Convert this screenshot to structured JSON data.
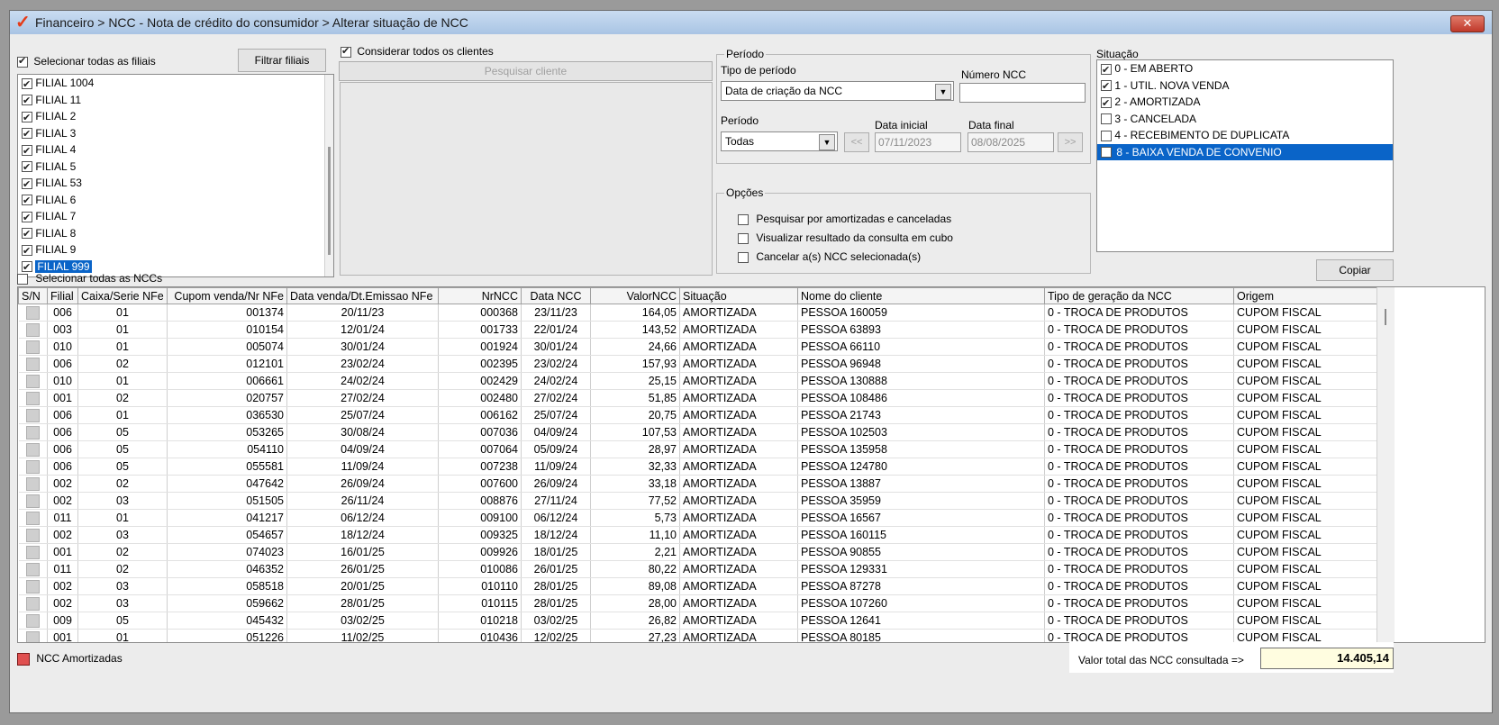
{
  "window": {
    "title": "Financeiro > NCC - Nota de crédito do consumidor > Alterar situação de NCC",
    "close_label": "✕"
  },
  "filiais": {
    "select_all_label": "Selecionar todas as filiais",
    "filter_button": "Filtrar filiais",
    "items": [
      "FILIAL 1004",
      "FILIAL 11",
      "FILIAL 2",
      "FILIAL 3",
      "FILIAL 4",
      "FILIAL 5",
      "FILIAL 53",
      "FILIAL 6",
      "FILIAL 7",
      "FILIAL 8",
      "FILIAL 9",
      "FILIAL 999"
    ],
    "selected": "FILIAL 999"
  },
  "clientes": {
    "consider_all_label": "Considerar todos os clientes",
    "search_button": "Pesquisar cliente"
  },
  "periodo": {
    "group_title": "Período",
    "tipo_label": "Tipo de período",
    "tipo_value": "Data de criação da NCC",
    "numero_label": "Número NCC",
    "numero_value": "",
    "periodo_label": "Período",
    "periodo_value": "Todas",
    "prev_label": "<<",
    "next_label": ">>",
    "data_inicial_label": "Data inicial",
    "data_inicial_value": "07/11/2023",
    "data_final_label": "Data final",
    "data_final_value": "08/08/2025"
  },
  "opcoes": {
    "group_title": "Opções",
    "items": [
      "Pesquisar por amortizadas e canceladas",
      "Visualizar resultado da consulta em cubo",
      "Cancelar a(s) NCC selecionada(s)"
    ]
  },
  "situacao": {
    "label": "Situação",
    "items": [
      {
        "label": "0 - EM ABERTO",
        "checked": true
      },
      {
        "label": "1 - UTIL. NOVA VENDA",
        "checked": true
      },
      {
        "label": "2 - AMORTIZADA",
        "checked": true
      },
      {
        "label": "3 - CANCELADA",
        "checked": false
      },
      {
        "label": "4 - RECEBIMENTO DE DUPLICATA",
        "checked": false
      },
      {
        "label": "8 - BAIXA VENDA DE CONVENIO",
        "checked": false
      }
    ],
    "selected": "8 - BAIXA VENDA DE CONVENIO"
  },
  "copiar_button": "Copiar",
  "select_all_ncc_label": "Selecionar todas as NCCs",
  "grid": {
    "columns": [
      "S/N",
      "Filial",
      "Caixa/Serie NFe",
      "Cupom venda/Nr NFe",
      "Data venda/Dt.Emissao NFe",
      "NrNCC",
      "Data NCC",
      "ValorNCC",
      "Situação",
      "Nome do cliente",
      "Tipo de geração da NCC",
      "Origem"
    ],
    "rows": [
      [
        "006",
        "01",
        "001374",
        "20/11/23",
        "000368",
        "23/11/23",
        "164,05",
        "AMORTIZADA",
        "PESSOA 160059",
        "0 - TROCA DE PRODUTOS",
        "CUPOM FISCAL"
      ],
      [
        "003",
        "01",
        "010154",
        "12/01/24",
        "001733",
        "22/01/24",
        "143,52",
        "AMORTIZADA",
        "PESSOA 63893",
        "0 - TROCA DE PRODUTOS",
        "CUPOM FISCAL"
      ],
      [
        "010",
        "01",
        "005074",
        "30/01/24",
        "001924",
        "30/01/24",
        "24,66",
        "AMORTIZADA",
        "PESSOA 66110",
        "0 - TROCA DE PRODUTOS",
        "CUPOM FISCAL"
      ],
      [
        "006",
        "02",
        "012101",
        "23/02/24",
        "002395",
        "23/02/24",
        "157,93",
        "AMORTIZADA",
        "PESSOA 96948",
        "0 - TROCA DE PRODUTOS",
        "CUPOM FISCAL"
      ],
      [
        "010",
        "01",
        "006661",
        "24/02/24",
        "002429",
        "24/02/24",
        "25,15",
        "AMORTIZADA",
        "PESSOA 130888",
        "0 - TROCA DE PRODUTOS",
        "CUPOM FISCAL"
      ],
      [
        "001",
        "02",
        "020757",
        "27/02/24",
        "002480",
        "27/02/24",
        "51,85",
        "AMORTIZADA",
        "PESSOA 108486",
        "0 - TROCA DE PRODUTOS",
        "CUPOM FISCAL"
      ],
      [
        "006",
        "01",
        "036530",
        "25/07/24",
        "006162",
        "25/07/24",
        "20,75",
        "AMORTIZADA",
        "PESSOA 21743",
        "0 - TROCA DE PRODUTOS",
        "CUPOM FISCAL"
      ],
      [
        "006",
        "05",
        "053265",
        "30/08/24",
        "007036",
        "04/09/24",
        "107,53",
        "AMORTIZADA",
        "PESSOA 102503",
        "0 - TROCA DE PRODUTOS",
        "CUPOM FISCAL"
      ],
      [
        "006",
        "05",
        "054110",
        "04/09/24",
        "007064",
        "05/09/24",
        "28,97",
        "AMORTIZADA",
        "PESSOA 135958",
        "0 - TROCA DE PRODUTOS",
        "CUPOM FISCAL"
      ],
      [
        "006",
        "05",
        "055581",
        "11/09/24",
        "007238",
        "11/09/24",
        "32,33",
        "AMORTIZADA",
        "PESSOA 124780",
        "0 - TROCA DE PRODUTOS",
        "CUPOM FISCAL"
      ],
      [
        "002",
        "02",
        "047642",
        "26/09/24",
        "007600",
        "26/09/24",
        "33,18",
        "AMORTIZADA",
        "PESSOA 13887",
        "0 - TROCA DE PRODUTOS",
        "CUPOM FISCAL"
      ],
      [
        "002",
        "03",
        "051505",
        "26/11/24",
        "008876",
        "27/11/24",
        "77,52",
        "AMORTIZADA",
        "PESSOA 35959",
        "0 - TROCA DE PRODUTOS",
        "CUPOM FISCAL"
      ],
      [
        "011",
        "01",
        "041217",
        "06/12/24",
        "009100",
        "06/12/24",
        "5,73",
        "AMORTIZADA",
        "PESSOA 16567",
        "0 - TROCA DE PRODUTOS",
        "CUPOM FISCAL"
      ],
      [
        "002",
        "03",
        "054657",
        "18/12/24",
        "009325",
        "18/12/24",
        "11,10",
        "AMORTIZADA",
        "PESSOA 160115",
        "0 - TROCA DE PRODUTOS",
        "CUPOM FISCAL"
      ],
      [
        "001",
        "02",
        "074023",
        "16/01/25",
        "009926",
        "18/01/25",
        "2,21",
        "AMORTIZADA",
        "PESSOA 90855",
        "0 - TROCA DE PRODUTOS",
        "CUPOM FISCAL"
      ],
      [
        "011",
        "02",
        "046352",
        "26/01/25",
        "010086",
        "26/01/25",
        "80,22",
        "AMORTIZADA",
        "PESSOA 129331",
        "0 - TROCA DE PRODUTOS",
        "CUPOM FISCAL"
      ],
      [
        "002",
        "03",
        "058518",
        "20/01/25",
        "010110",
        "28/01/25",
        "89,08",
        "AMORTIZADA",
        "PESSOA 87278",
        "0 - TROCA DE PRODUTOS",
        "CUPOM FISCAL"
      ],
      [
        "002",
        "03",
        "059662",
        "28/01/25",
        "010115",
        "28/01/25",
        "28,00",
        "AMORTIZADA",
        "PESSOA 107260",
        "0 - TROCA DE PRODUTOS",
        "CUPOM FISCAL"
      ],
      [
        "009",
        "05",
        "045432",
        "03/02/25",
        "010218",
        "03/02/25",
        "26,82",
        "AMORTIZADA",
        "PESSOA 12641",
        "0 - TROCA DE PRODUTOS",
        "CUPOM FISCAL"
      ],
      [
        "001",
        "01",
        "051226",
        "11/02/25",
        "010436",
        "12/02/25",
        "27,23",
        "AMORTIZADA",
        "PESSOA 80185",
        "0 - TROCA DE PRODUTOS",
        "CUPOM FISCAL"
      ]
    ]
  },
  "footer": {
    "legend_label": "NCC Amortizadas",
    "legend_color": "#e05050",
    "total_label": "Valor total das NCC consultada =>",
    "total_value": "14.405,14"
  }
}
